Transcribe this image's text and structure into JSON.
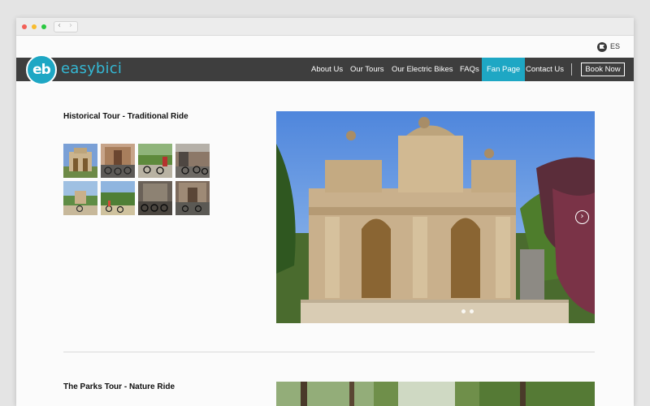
{
  "language": {
    "label": "ES",
    "icon": "flag-icon"
  },
  "brand": {
    "logo_mark": "eb",
    "name": "easybici"
  },
  "nav": {
    "items": [
      {
        "label": "About Us"
      },
      {
        "label": "Our Tours"
      },
      {
        "label": "Our Electric Bikes"
      },
      {
        "label": "FAQs"
      },
      {
        "label": "Fan Page",
        "active": true
      },
      {
        "label": "Contact Us"
      }
    ],
    "book_label": "Book Now"
  },
  "tours": [
    {
      "title": "Historical Tour - Traditional Ride"
    },
    {
      "title": "The Parks Tour - Nature Ride"
    }
  ],
  "colors": {
    "accent": "#1ea7c4",
    "navbar": "#3e3e3e",
    "page": "#fbfbfb"
  }
}
